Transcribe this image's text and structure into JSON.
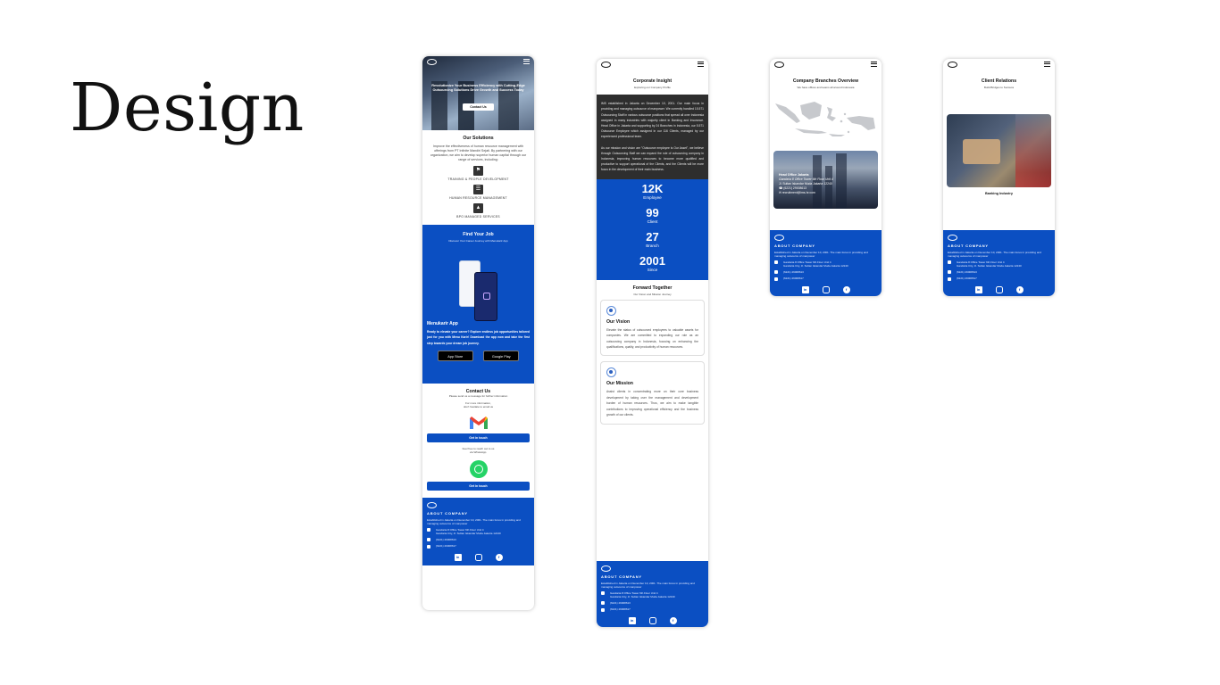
{
  "page": {
    "heading": "Design"
  },
  "brand": {
    "primary_color": "#0b4fc2",
    "dark_color": "#2e2e2e",
    "logo_text": "IHS"
  },
  "home": {
    "hero_text": "Revolutionize Your Business Efficiency with Cutting-Edge Outsourcing Solutions Drive Growth and Success Today",
    "hero_button": "Contact Us",
    "solutions_title": "Our Solutions",
    "solutions_intro": "Improve the effectiveness of human resource management with offerings from PT Infinite Mandiri Sejati. By partnering with our organization, we aim to develop superior human capital through our range of services, including:",
    "solutions": [
      {
        "label": "TRAINING & PEOPLE DEVELOPMENT",
        "icon": "training-icon"
      },
      {
        "label": "HUMAN RESOURCE MANAGEMENT",
        "icon": "org-chart-icon"
      },
      {
        "label": "BPO MANAGED SERVICES",
        "icon": "flame-icon"
      }
    ],
    "job_title": "Find Your Job",
    "job_subtitle": "Discover Your Career Journey with Menukarir App",
    "app_name": "Menukarir App",
    "app_description": "Ready to elevate your career? Explore endless job opportunities tailored just for you with Menu Karir! Download the app now and take the first step towards your dream job journey.",
    "app_store_label": "App Store",
    "google_play_label": "Google Play",
    "contact_title": "Contact Us",
    "contact_subtitle": "Please send us a message for further information",
    "contact_email_note_1": "For more information,",
    "contact_email_note_2": "don't hesitate to email us",
    "get_in_touch": "Get in touch",
    "contact_wa_note_1": "Feel free to reach out to us",
    "contact_wa_note_2": "via WhatsApp."
  },
  "footer": {
    "about_title": "ABOUT COMPANY",
    "about_text": "Established in Jakarta on December 10, 2001. The main focus in providing and managing outsource of manpower",
    "address_line_1": "Gandaria 8 Office Tower 6th Floor Unit 4",
    "address_line_2": "Gandaria City, Jl. Sultan Iskandar Muda Jakarta 12240",
    "phone_1": "(6221) 29008613",
    "phone_2": "(6221) 29008617"
  },
  "about": {
    "title": "Corporate Insight",
    "subtitle": "Exploring our Company Profile",
    "paragraph_1": "IMS established in Jakarta on December 10, 2001. Our main focus in providing and managing outsource of manpower. We currently handled 15.571 Outsourcing Staff in various outsource positions that spread all over Indonesia assigned in many industries with majority client in Banking and Insurance. Head Office in Jakarta and supporting by 24 Branches in Indonesia, our 5.571 Outsource Employee which assigned in our 116 Clients, managed by our experienced professional team.",
    "paragraph_2": "As our mission and vision are \"Outsource employee is Our Asset\", we believe through Outsourcing Staff we can expand the role of outsourcing company in Indonesia, improving human resources to become more qualified and productive to support operational of the Clients, and the Clients will be more focus in the development of their main business.",
    "stats": [
      {
        "value": "12K",
        "label": "Employee"
      },
      {
        "value": "99",
        "label": "Client"
      },
      {
        "value": "27",
        "label": "Branch"
      },
      {
        "value": "2001",
        "label": "Since"
      }
    ],
    "forward_title": "Forward Together",
    "forward_subtitle": "Our Vision and Mission Journey",
    "vision_title": "Our Vision",
    "vision_text": "Elevate the status of outsourced employees to valuable assets for companies. We are committed to expanding our role as an outsourcing company in Indonesia, focusing on enhancing the qualifications, quality, and productivity of human resources.",
    "mission_title": "Our Mission",
    "mission_text": "Assist clients in concentrating more on their core business development by taking over the management and development burden of human resources. Thus, we aim to make tangible contributions to improving operational efficiency and the business growth of our clients."
  },
  "branches": {
    "title": "Company Branches Overview",
    "subtitle": "We have offices and teams all around Indonesia",
    "office_title": "Head Office Jakarta",
    "office_address_1": "Gandaria 8 Office Tower 6th Floor Unit 4",
    "office_address_2": "Jl. Sultan Iskandar Muda Jakarta 12240",
    "office_phone": "(6221) 29008613",
    "office_email": "recruitment@ims-hr.com"
  },
  "clients": {
    "title": "Client Relations",
    "subtitle": "Build Bridges to Success",
    "industry": "Banking Industry"
  }
}
